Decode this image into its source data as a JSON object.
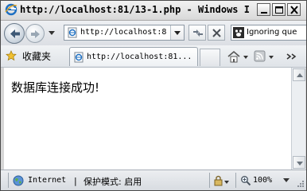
{
  "window": {
    "title": "http://localhost:81/13-1.php - Windows I..."
  },
  "navbar": {
    "address": "http://localhost:8",
    "search_text": "Ignoring que"
  },
  "favorites": {
    "label": "收藏夹"
  },
  "tab": {
    "title": "http://localhost:81..."
  },
  "content": {
    "message": "数据库连接成功!"
  },
  "statusbar": {
    "zone": "Internet",
    "separator": "|",
    "protected_mode": "保护模式: 启用",
    "zoom": "100%"
  },
  "colors": {
    "ie_blue": "#1d6fc2",
    "close_red": "#c00000"
  }
}
